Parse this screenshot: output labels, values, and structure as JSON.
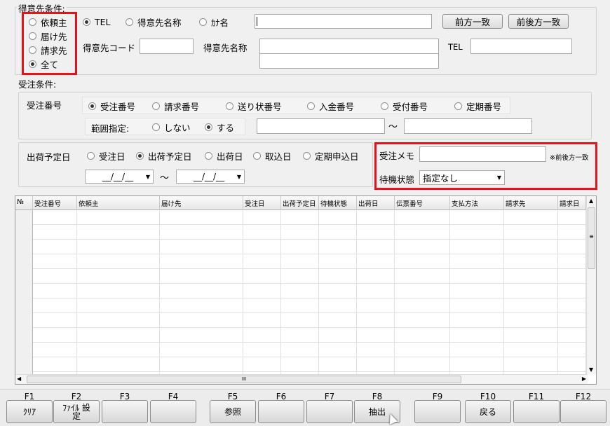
{
  "customer": {
    "group_label": "得意先条件:",
    "type_options": [
      "依頼主",
      "届け先",
      "請求先",
      "全て"
    ],
    "type_selected": 3,
    "search_options": [
      "TEL",
      "得意先名称",
      "ｶﾅ名"
    ],
    "search_selected": 0,
    "search_value": "",
    "match_buttons": [
      "前方一致",
      "前後方一致"
    ],
    "code_label": "得意先コード",
    "name_label": "得意先名称",
    "tel_label": "TEL"
  },
  "order": {
    "group_label": "受注条件:",
    "number_label": "受注番号",
    "number_options": [
      "受注番号",
      "請求番号",
      "送り状番号",
      "入金番号",
      "受付番号",
      "定期番号"
    ],
    "number_selected": 0,
    "range_label": "範囲指定:",
    "range_options": [
      "しない",
      "する"
    ],
    "range_selected": 1,
    "range_sep": "～",
    "ship_label": "出荷予定日",
    "date_options": [
      "受注日",
      "出荷予定日",
      "出荷日",
      "取込日",
      "定期申込日"
    ],
    "date_selected": 1,
    "date_from": "__/__/__",
    "date_to": "__/__/__",
    "date_sep": "～",
    "memo_label": "受注メモ",
    "memo_note": "※前後方一致",
    "wait_label": "待機状態",
    "wait_value": "指定なし"
  },
  "grid": {
    "columns": [
      "№",
      "受注番号",
      "依頼主",
      "届け先",
      "受注日",
      "出荷予定日",
      "待機状態",
      "出荷日",
      "伝票番号",
      "支払方法",
      "請求先",
      "請求日"
    ],
    "rows": 12,
    "scroll_mark": "≡",
    "hscroll_mark": "III"
  },
  "fkeys": [
    {
      "key": "F1",
      "label": "ｸﾘｱ"
    },
    {
      "key": "F2",
      "label": "ﾌｧｲﾙ 設定"
    },
    {
      "key": "F3",
      "label": ""
    },
    {
      "key": "F4",
      "label": ""
    },
    {
      "key": "F5",
      "label": "参照"
    },
    {
      "key": "F6",
      "label": ""
    },
    {
      "key": "F7",
      "label": ""
    },
    {
      "key": "F8",
      "label": "抽出"
    },
    {
      "key": "F9",
      "label": ""
    },
    {
      "key": "F10",
      "label": "戻る"
    },
    {
      "key": "F11",
      "label": ""
    },
    {
      "key": "F12",
      "label": ""
    }
  ],
  "colors": {
    "highlight": "#e8121a",
    "background": "#f0f0f0"
  }
}
